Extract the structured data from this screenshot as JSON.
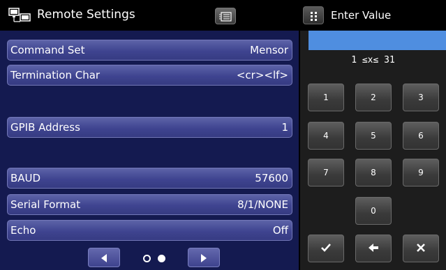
{
  "header": {
    "title": "Remote Settings",
    "title_icon": "network-computers-icon",
    "menu_icon": "menu-list-icon"
  },
  "settings": {
    "rows": [
      {
        "label": "Command Set",
        "value": "Mensor"
      },
      {
        "label": "Termination Char",
        "value": "<cr><lf>"
      },
      {
        "label": "GPIB Address",
        "value": "1"
      },
      {
        "label": "BAUD",
        "value": "57600"
      },
      {
        "label": "Serial Format",
        "value": "8/1/NONE"
      },
      {
        "label": "Echo",
        "value": "Off"
      }
    ]
  },
  "pager": {
    "prev_icon": "left-triangle-icon",
    "next_icon": "right-triangle-icon",
    "page_count": 2,
    "current_page": 2
  },
  "keypad": {
    "title": "Enter Value",
    "grip_icon": "grip-dots-icon",
    "input_value": "",
    "range_text": "1  ≤x≤  31",
    "keys": [
      "1",
      "2",
      "3",
      "4",
      "5",
      "6",
      "7",
      "8",
      "9",
      "0"
    ],
    "confirm_icon": "check-icon",
    "backspace_icon": "arrow-left-icon",
    "cancel_icon": "x-icon"
  },
  "colors": {
    "row_fill": "#3f4490",
    "list_bg": "#141a50",
    "input_bar": "#4f8ee0",
    "keypad_bg": "#1d1d1d"
  }
}
